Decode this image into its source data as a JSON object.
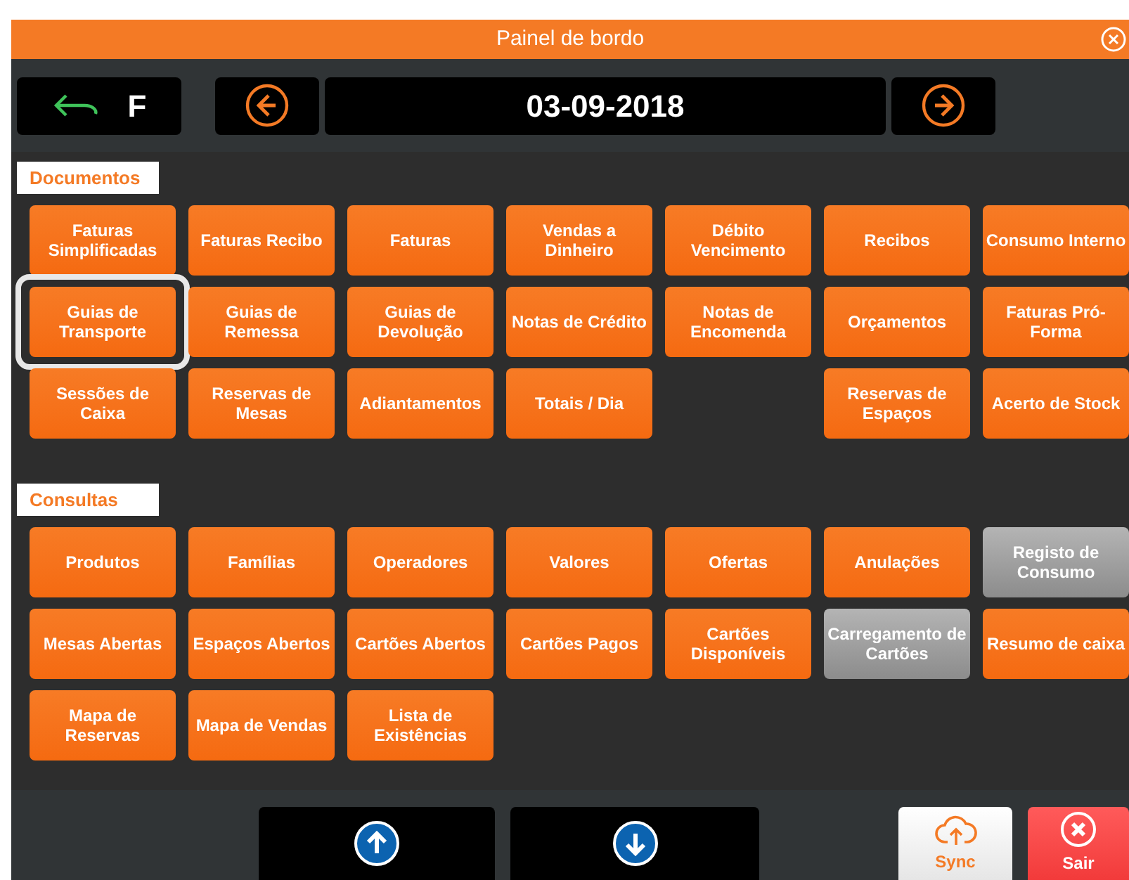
{
  "window": {
    "title": "Painel de bordo"
  },
  "toolbar": {
    "back_label": "F",
    "date": "03-09-2018"
  },
  "sections": [
    {
      "title": "Documentos",
      "items": [
        {
          "kind": "button",
          "label": "Faturas Simplificadas",
          "disabled": false,
          "selected": false
        },
        {
          "kind": "button",
          "label": "Faturas Recibo",
          "disabled": false,
          "selected": false
        },
        {
          "kind": "button",
          "label": "Faturas",
          "disabled": false,
          "selected": false
        },
        {
          "kind": "button",
          "label": "Vendas a Dinheiro",
          "disabled": false,
          "selected": false
        },
        {
          "kind": "button",
          "label": "Débito Vencimento",
          "disabled": false,
          "selected": false
        },
        {
          "kind": "button",
          "label": "Recibos",
          "disabled": false,
          "selected": false
        },
        {
          "kind": "button",
          "label": "Consumo Interno",
          "disabled": false,
          "selected": false
        },
        {
          "kind": "button",
          "label": "Guias de Transporte",
          "disabled": false,
          "selected": true
        },
        {
          "kind": "button",
          "label": "Guias de Remessa",
          "disabled": false,
          "selected": false
        },
        {
          "kind": "button",
          "label": "Guias de Devolução",
          "disabled": false,
          "selected": false
        },
        {
          "kind": "button",
          "label": "Notas de Crédito",
          "disabled": false,
          "selected": false
        },
        {
          "kind": "button",
          "label": "Notas de Encomenda",
          "disabled": false,
          "selected": false
        },
        {
          "kind": "button",
          "label": "Orçamentos",
          "disabled": false,
          "selected": false
        },
        {
          "kind": "button",
          "label": "Faturas Pró-Forma",
          "disabled": false,
          "selected": false
        },
        {
          "kind": "button",
          "label": "Sessões de Caixa",
          "disabled": false,
          "selected": false
        },
        {
          "kind": "button",
          "label": "Reservas de Mesas",
          "disabled": false,
          "selected": false
        },
        {
          "kind": "button",
          "label": "Adiantamentos",
          "disabled": false,
          "selected": false
        },
        {
          "kind": "button",
          "label": "Totais / Dia",
          "disabled": false,
          "selected": false
        },
        {
          "kind": "blank"
        },
        {
          "kind": "button",
          "label": "Reservas de Espaços",
          "disabled": false,
          "selected": false
        },
        {
          "kind": "button",
          "label": "Acerto de Stock",
          "disabled": false,
          "selected": false
        }
      ]
    },
    {
      "title": "Consultas",
      "items": [
        {
          "kind": "button",
          "label": "Produtos",
          "disabled": false,
          "selected": false
        },
        {
          "kind": "button",
          "label": "Famílias",
          "disabled": false,
          "selected": false
        },
        {
          "kind": "button",
          "label": "Operadores",
          "disabled": false,
          "selected": false
        },
        {
          "kind": "button",
          "label": "Valores",
          "disabled": false,
          "selected": false
        },
        {
          "kind": "button",
          "label": "Ofertas",
          "disabled": false,
          "selected": false
        },
        {
          "kind": "button",
          "label": "Anulações",
          "disabled": false,
          "selected": false
        },
        {
          "kind": "button",
          "label": "Registo de Consumo",
          "disabled": true,
          "selected": false
        },
        {
          "kind": "button",
          "label": "Mesas Abertas",
          "disabled": false,
          "selected": false
        },
        {
          "kind": "button",
          "label": "Espaços Abertos",
          "disabled": false,
          "selected": false
        },
        {
          "kind": "button",
          "label": "Cartões Abertos",
          "disabled": false,
          "selected": false
        },
        {
          "kind": "button",
          "label": "Cartões Pagos",
          "disabled": false,
          "selected": false
        },
        {
          "kind": "button",
          "label": "Cartões Disponíveis",
          "disabled": false,
          "selected": false
        },
        {
          "kind": "button",
          "label": "Carregamento de Cartões",
          "disabled": true,
          "selected": false
        },
        {
          "kind": "button",
          "label": "Resumo de caixa",
          "disabled": false,
          "selected": false
        },
        {
          "kind": "button",
          "label": "Mapa de Reservas",
          "disabled": false,
          "selected": false
        },
        {
          "kind": "button",
          "label": "Mapa de Vendas",
          "disabled": false,
          "selected": false
        },
        {
          "kind": "button",
          "label": "Lista de Existências",
          "disabled": false,
          "selected": false
        }
      ]
    }
  ],
  "footer": {
    "sync_label": "Sync",
    "exit_label": "Sair"
  }
}
